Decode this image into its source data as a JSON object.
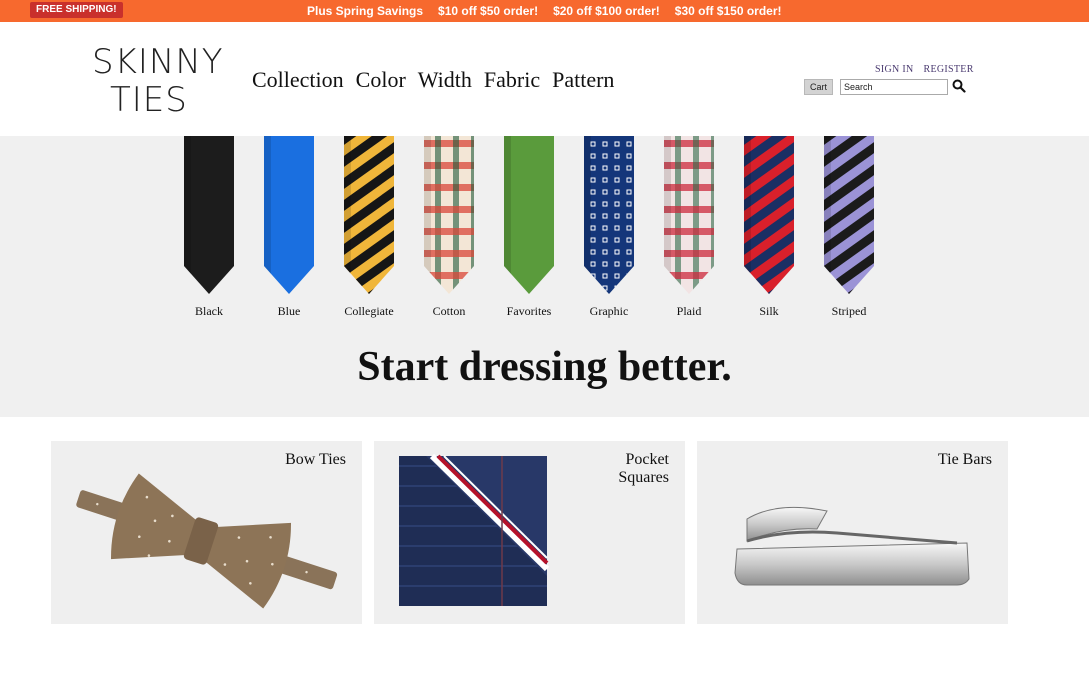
{
  "promo": {
    "badge": "FREE SHIPPING!",
    "items": [
      "Plus Spring Savings",
      "$10 off $50 order!",
      "$20 off $100 order!",
      "$30 off $150 order!"
    ]
  },
  "brand": {
    "line1": "SKINNY",
    "line2": "TIES"
  },
  "nav": {
    "items": [
      "Collection",
      "Color",
      "Width",
      "Fabric",
      "Pattern"
    ]
  },
  "account": {
    "sign_in": "SIGN IN",
    "register": "REGISTER",
    "cart_label": "Cart",
    "search_placeholder": "Search",
    "search_icon": "search-icon"
  },
  "hero": {
    "title": "Start dressing better.",
    "ties": [
      {
        "label": "Black",
        "pattern": "solid",
        "colors": [
          "#1c1c1c"
        ]
      },
      {
        "label": "Blue",
        "pattern": "solid",
        "colors": [
          "#1a6fe0"
        ]
      },
      {
        "label": "Collegiate",
        "pattern": "stripe",
        "colors": [
          "#f0b63a",
          "#161616"
        ]
      },
      {
        "label": "Cotton",
        "pattern": "plaid",
        "colors": [
          "#f3e6d6",
          "#d9473a",
          "#1f5a3a"
        ]
      },
      {
        "label": "Favorites",
        "pattern": "solid",
        "colors": [
          "#5a9b3c"
        ]
      },
      {
        "label": "Graphic",
        "pattern": "dots",
        "colors": [
          "#14367a",
          "#ffffff"
        ]
      },
      {
        "label": "Plaid",
        "pattern": "plaid",
        "colors": [
          "#f2e4e4",
          "#cc2b3d",
          "#2e6b4a"
        ]
      },
      {
        "label": "Silk",
        "pattern": "stripe",
        "colors": [
          "#d9202b",
          "#1a2f64"
        ]
      },
      {
        "label": "Striped",
        "pattern": "stripe",
        "colors": [
          "#9b93d6",
          "#1b1b1b"
        ]
      }
    ]
  },
  "tiles": [
    {
      "label_lines": [
        "Bow Ties"
      ],
      "icon": "bow-tie-image"
    },
    {
      "label_lines": [
        "Pocket",
        "Squares"
      ],
      "icon": "pocket-square-image"
    },
    {
      "label_lines": [
        "Tie Bars"
      ],
      "icon": "tie-bar-image"
    }
  ]
}
